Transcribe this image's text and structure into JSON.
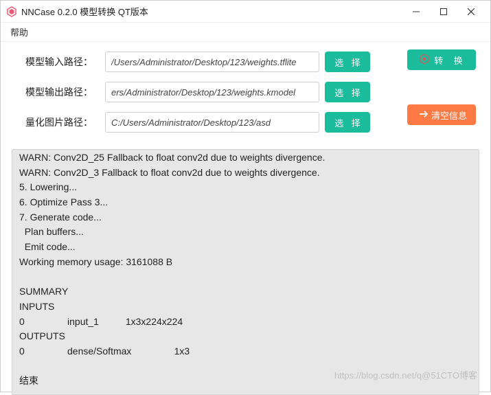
{
  "window": {
    "title": "NNCase 0.2.0 模型转换 QT版本"
  },
  "menu": {
    "help": "帮助"
  },
  "form": {
    "input_label": "模型输入路径：",
    "input_value": "/Users/Administrator/Desktop/123/weights.tflite",
    "output_label": "模型输出路径：",
    "output_value": "ers/Administrator/Desktop/123/weights.kmodel",
    "quant_label": "量化图片路径：",
    "quant_value": "C:/Users/Administrator/Desktop/123/asd",
    "select_btn": "选 择"
  },
  "actions": {
    "convert": "转 换",
    "clear": "清空信息"
  },
  "log": "WARN: Conv2D_25 Fallback to float conv2d due to weights divergence.\nWARN: Conv2D_3 Fallback to float conv2d due to weights divergence.\n5. Lowering...\n6. Optimize Pass 3...\n7. Generate code...\n  Plan buffers...\n  Emit code...\nWorking memory usage: 3161088 B\n\nSUMMARY\nINPUTS\n0                input_1          1x3x224x224\nOUTPUTS\n0                dense/Softmax                1x3\n\n结束",
  "watermark": "https://blog.csdn.net/q@51CTO博客"
}
